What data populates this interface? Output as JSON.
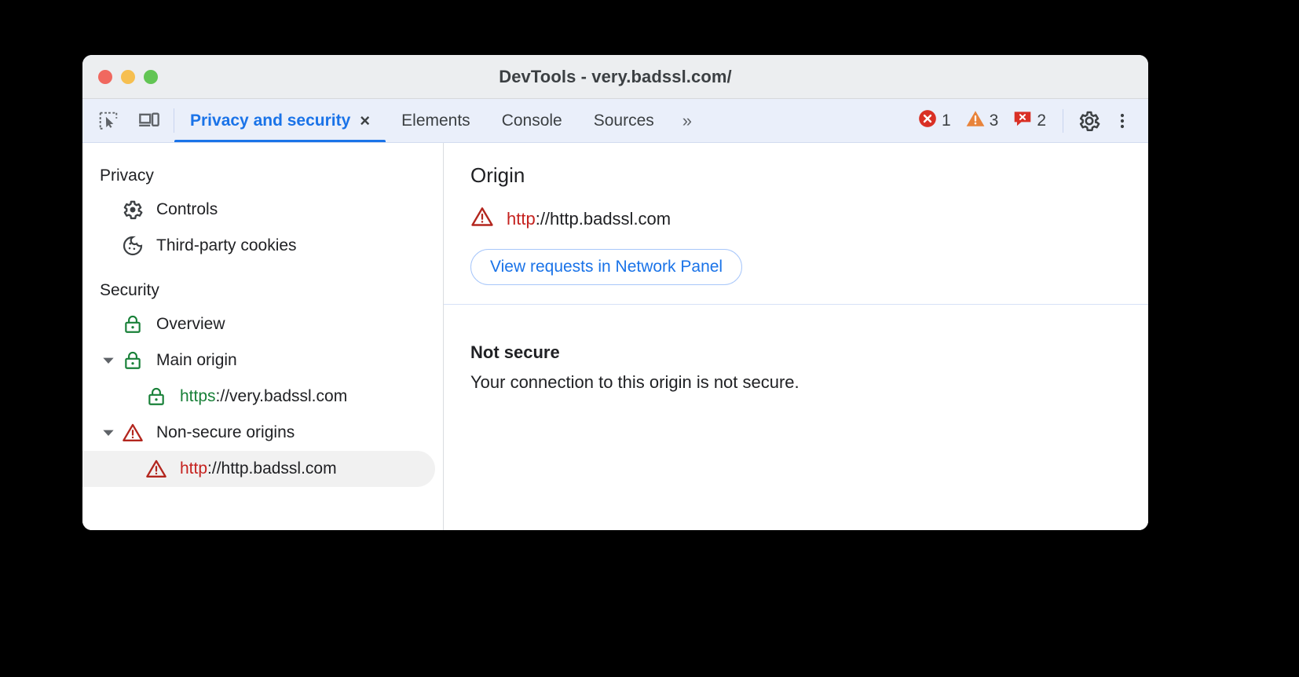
{
  "window": {
    "title": "DevTools - very.badssl.com/",
    "traffic_lights": [
      "close",
      "minimize",
      "zoom"
    ]
  },
  "toolbar": {
    "left_icons": [
      {
        "name": "inspect-element-icon",
        "label": "Inspect element"
      },
      {
        "name": "device-toolbar-icon",
        "label": "Toggle device toolbar"
      }
    ],
    "tabs": [
      {
        "label": "Privacy and security",
        "active": true,
        "closable": true,
        "close_label": "×"
      },
      {
        "label": "Elements",
        "active": false
      },
      {
        "label": "Console",
        "active": false
      },
      {
        "label": "Sources",
        "active": false
      }
    ],
    "overflow_label": "»",
    "badges": [
      {
        "icon": "error-icon",
        "count": "1"
      },
      {
        "icon": "warning-icon",
        "count": "3"
      },
      {
        "icon": "issue-icon",
        "count": "2"
      }
    ],
    "settings_label": "Settings",
    "more_label": "Customize and control DevTools"
  },
  "sidebar": {
    "sections": [
      {
        "title": "Privacy",
        "items": [
          {
            "label": "Controls",
            "icon": "gear-icon",
            "indent": 1,
            "twisty": "none",
            "selected": false
          },
          {
            "label": "Third-party cookies",
            "icon": "cookie-icon",
            "indent": 1,
            "twisty": "none",
            "selected": false
          }
        ]
      },
      {
        "title": "Security",
        "items": [
          {
            "label": "Overview",
            "icon": "lock-green-icon",
            "indent": 1,
            "twisty": "none",
            "selected": false
          },
          {
            "label": "Main origin",
            "icon": "lock-green-icon",
            "indent": 0,
            "twisty": "expanded",
            "selected": false
          },
          {
            "scheme": "https",
            "rest": "://very.badssl.com",
            "icon": "lock-green-icon",
            "indent": 2,
            "twisty": "none",
            "selected": false
          },
          {
            "label": "Non-secure origins",
            "icon": "warning-red-icon",
            "indent": 0,
            "twisty": "expanded",
            "selected": false
          },
          {
            "scheme": "http",
            "rest": "://http.badssl.com",
            "icon": "warning-red-icon",
            "indent": 2,
            "twisty": "none",
            "selected": true
          }
        ]
      }
    ]
  },
  "main": {
    "origin": {
      "heading": "Origin",
      "icon": "warning-red-icon",
      "scheme": "http",
      "rest": "://http.badssl.com",
      "button_label": "View requests in Network Panel"
    },
    "connection": {
      "heading": "Not secure",
      "text": "Your connection to this origin is not secure."
    }
  },
  "colors": {
    "accent_blue": "#1a73e8",
    "secure_green": "#188038",
    "insecure_red": "#c5221f",
    "warning_orange": "#e8833a",
    "titlebar": "#eceef0",
    "tabstrip": "#eaeffa",
    "selected_row": "#f1f1f1"
  }
}
